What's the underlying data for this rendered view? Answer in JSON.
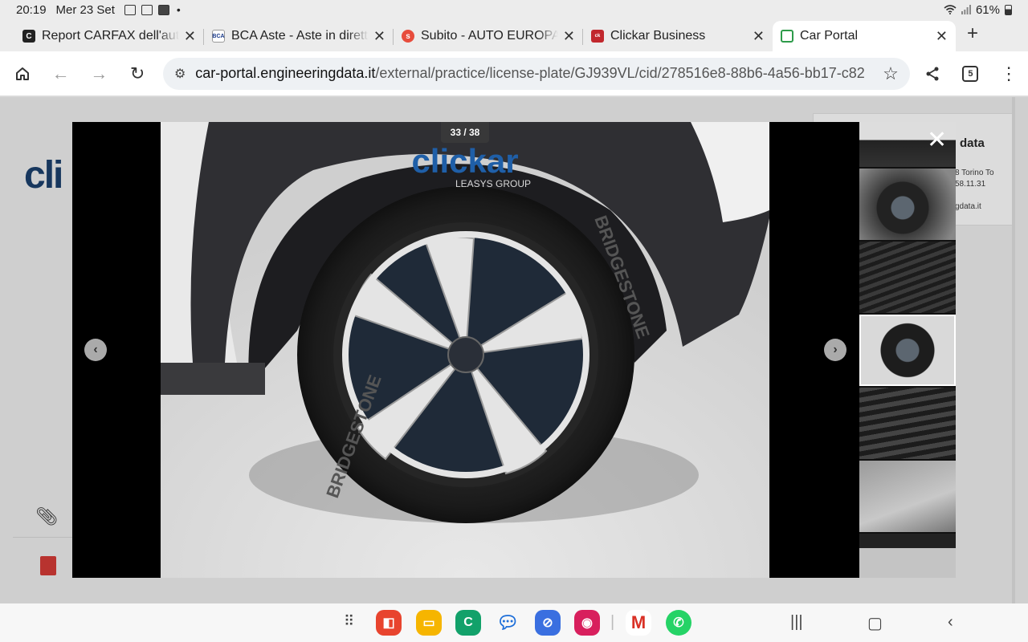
{
  "status_bar": {
    "time": "20:19",
    "date": "Mer 23 Set",
    "battery": "61%",
    "battery_level": 0.61
  },
  "tabs": [
    {
      "title": "Report CARFAX dell'auto",
      "favicon": "carfax",
      "active": false
    },
    {
      "title": "BCA Aste - Aste in diretta",
      "favicon": "bca",
      "active": false
    },
    {
      "title": "Subito - AUTO EUROPA S",
      "favicon": "subito",
      "active": false
    },
    {
      "title": "Clickar Business",
      "favicon": "clickar",
      "active": false
    },
    {
      "title": "Car Portal",
      "favicon": "car-portal",
      "active": true
    }
  ],
  "toolbar": {
    "url_host": "car-portal.engineeringdata.it",
    "url_path": "/external/practice/license-plate/GJ939VL/cid/278516e8-88b6-4a56-bb17-c82",
    "tab_count": "5"
  },
  "background_page": {
    "logo_text": "cli",
    "card_title": "data",
    "card_line1": "8 Torino To",
    "card_line2": "58.11.31",
    "card_line3": "gdata.it"
  },
  "lightbox": {
    "counter": "33 / 38",
    "watermark_brand": "clickar",
    "watermark_sub": "LEASYS GROUP",
    "tire_brand": "BRIDGESTONE"
  },
  "colors": {
    "accent_blue": "#1f5fa8",
    "watermark_red": "#e2242b",
    "modal_bg": "#000000"
  }
}
